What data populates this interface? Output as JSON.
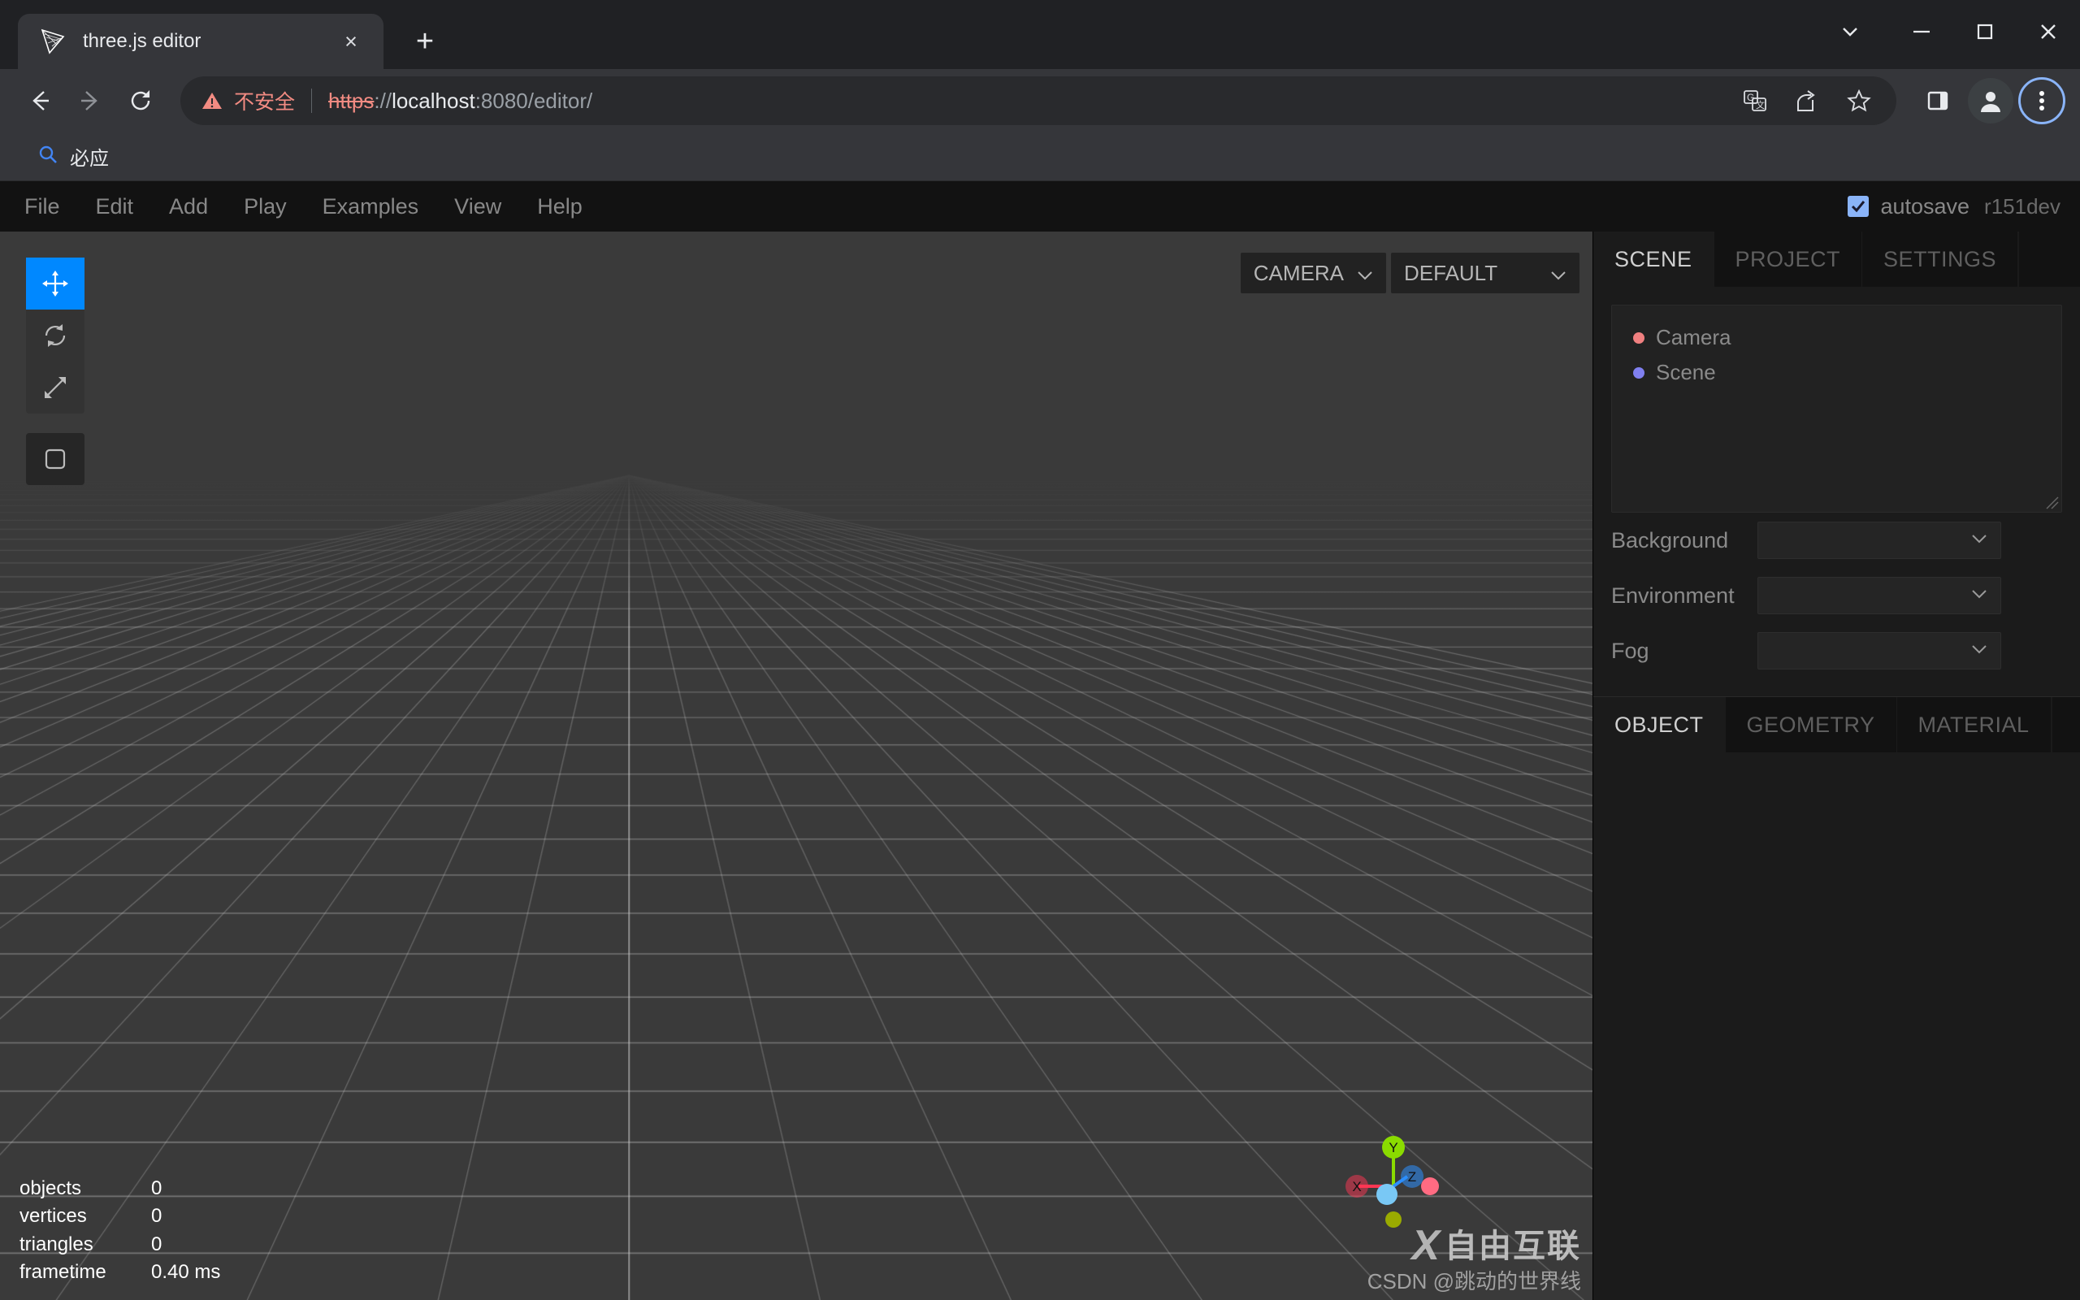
{
  "browser": {
    "tab": {
      "title": "three.js editor",
      "favicon": "threejs-logo-icon",
      "close": "×"
    },
    "new_tab_label": "+",
    "window_controls": {
      "tab_search": "tab-search-chevron",
      "minimize": "—",
      "maximize": "□",
      "close": "✕"
    },
    "nav": {
      "back": "←",
      "forward": "→",
      "reload": "⟳"
    },
    "omnibox": {
      "security_label": "不安全",
      "url_scheme": "https",
      "url_separator": "://",
      "url_host": "localhost",
      "url_rest": ":8080/editor/",
      "full_url": "https://localhost:8080/editor/"
    },
    "toolbar_icons": [
      "translate-icon",
      "share-icon",
      "bookmark-star-icon",
      "side-panel-icon",
      "profile-avatar-icon",
      "chrome-menu-icon"
    ],
    "bookmarks": [
      {
        "label": "必应",
        "icon": "search-icon"
      }
    ]
  },
  "editor": {
    "menubar": {
      "items": [
        {
          "label": "File"
        },
        {
          "label": "Edit"
        },
        {
          "label": "Add"
        },
        {
          "label": "Play"
        },
        {
          "label": "Examples"
        },
        {
          "label": "View"
        },
        {
          "label": "Help"
        }
      ],
      "autosave_label": "autosave",
      "autosave_checked": true,
      "version": "r151dev"
    },
    "viewport": {
      "tools": [
        {
          "name": "translate",
          "icon": "move-arrows-icon",
          "active": true
        },
        {
          "name": "rotate",
          "icon": "rotate-icon",
          "active": false
        },
        {
          "name": "scale",
          "icon": "scale-arrows-icon",
          "active": false
        }
      ],
      "toggle_tool": {
        "name": "local-world-toggle",
        "icon": "square-icon"
      },
      "camera_select": {
        "value": "CAMERA"
      },
      "shading_select": {
        "value": "DEFAULT"
      },
      "stats": [
        {
          "label": "objects",
          "value": "0"
        },
        {
          "label": "vertices",
          "value": "0"
        },
        {
          "label": "triangles",
          "value": "0"
        },
        {
          "label": "frametime",
          "value": "0.40 ms"
        }
      ],
      "gizmo": {
        "x_label": "X",
        "y_label": "Y",
        "z_label": "Z",
        "x_color": "#ff3653",
        "y_color": "#8adb00",
        "z_color": "#2c8fff"
      }
    },
    "sidebar": {
      "tabs": [
        {
          "label": "SCENE",
          "active": true
        },
        {
          "label": "PROJECT",
          "active": false
        },
        {
          "label": "SETTINGS",
          "active": false
        }
      ],
      "outliner": [
        {
          "label": "Camera",
          "dot_color": "#f08080"
        },
        {
          "label": "Scene",
          "dot_color": "#8080f0"
        }
      ],
      "properties": [
        {
          "label": "Background",
          "value": ""
        },
        {
          "label": "Environment",
          "value": ""
        },
        {
          "label": "Fog",
          "value": ""
        }
      ],
      "object_tabs": [
        {
          "label": "OBJECT",
          "active": true
        },
        {
          "label": "GEOMETRY",
          "active": false
        },
        {
          "label": "MATERIAL",
          "active": false
        }
      ]
    },
    "watermark": {
      "logo_x": "X",
      "logo_text": "自由互联",
      "credit": "CSDN @跳动的世界线"
    }
  },
  "colors": {
    "accent_blue": "#0088ff",
    "checkbox_blue": "#8ab4f8",
    "warning_red": "#f28b82",
    "viewport_bg": "#3a3a3a",
    "panel_bg": "#1b1b1b",
    "menubar_bg": "#121212"
  }
}
